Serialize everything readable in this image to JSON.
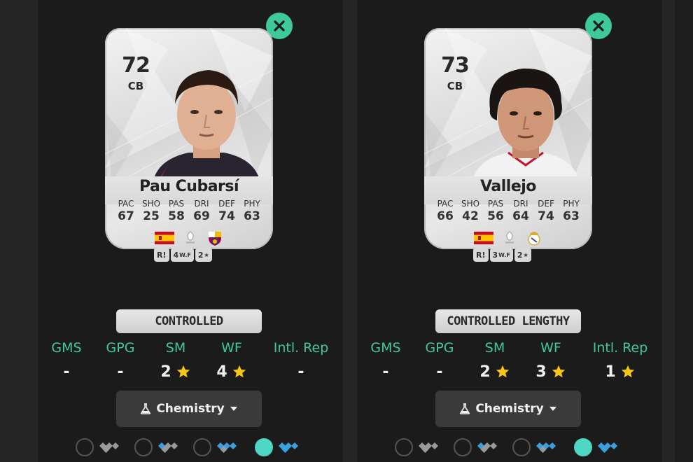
{
  "players": [
    {
      "card": {
        "rating": "72",
        "position": "CB",
        "name": "Pau Cubarsí",
        "stats": [
          {
            "label": "PAC",
            "value": "67"
          },
          {
            "label": "SHO",
            "value": "25"
          },
          {
            "label": "PAS",
            "value": "58"
          },
          {
            "label": "DRI",
            "value": "69"
          },
          {
            "label": "DEF",
            "value": "74"
          },
          {
            "label": "PHY",
            "value": "63"
          }
        ],
        "foot": "R",
        "weak_foot": "4",
        "weak_foot_label": "W.F",
        "skill_moves": "2",
        "nation_icon": "spain-flag-icon",
        "league_icon": "laliga-icon",
        "club_icon": "barcelona-crest-icon"
      },
      "accel_type": "CONTROLLED",
      "info": [
        {
          "label": "GMS",
          "value": "-"
        },
        {
          "label": "GPG",
          "value": "-"
        },
        {
          "label": "SM",
          "value": "2",
          "star": true
        },
        {
          "label": "WF",
          "value": "4",
          "star": true
        },
        {
          "label": "Intl. Rep",
          "value": "-"
        }
      ],
      "chemistry_label": "Chemistry",
      "chem_levels": [
        0,
        1,
        2,
        3
      ],
      "chem_active_index": 3
    },
    {
      "card": {
        "rating": "73",
        "position": "CB",
        "name": "Vallejo",
        "stats": [
          {
            "label": "PAC",
            "value": "66"
          },
          {
            "label": "SHO",
            "value": "42"
          },
          {
            "label": "PAS",
            "value": "56"
          },
          {
            "label": "DRI",
            "value": "64"
          },
          {
            "label": "DEF",
            "value": "74"
          },
          {
            "label": "PHY",
            "value": "63"
          }
        ],
        "foot": "R",
        "weak_foot": "3",
        "weak_foot_label": "W.F",
        "skill_moves": "2",
        "nation_icon": "spain-flag-icon",
        "league_icon": "laliga-icon",
        "club_icon": "real-madrid-crest-icon"
      },
      "accel_type": "CONTROLLED LENGTHY",
      "info": [
        {
          "label": "GMS",
          "value": "-"
        },
        {
          "label": "GPG",
          "value": "-"
        },
        {
          "label": "SM",
          "value": "2",
          "star": true
        },
        {
          "label": "WF",
          "value": "3",
          "star": true
        },
        {
          "label": "Intl. Rep",
          "value": "1",
          "star": true
        }
      ],
      "chemistry_label": "Chemistry",
      "chem_levels": [
        0,
        1,
        2,
        3
      ],
      "chem_active_index": 3
    }
  ],
  "colors": {
    "accent": "#3ec99a",
    "panel_bg": "#1b1b1b",
    "page_bg": "#262626",
    "star": "#f5c518",
    "chem_active": "#4fd6c2",
    "diamond_blue": "#3aa0e0",
    "diamond_grey": "#9a9a9a"
  }
}
